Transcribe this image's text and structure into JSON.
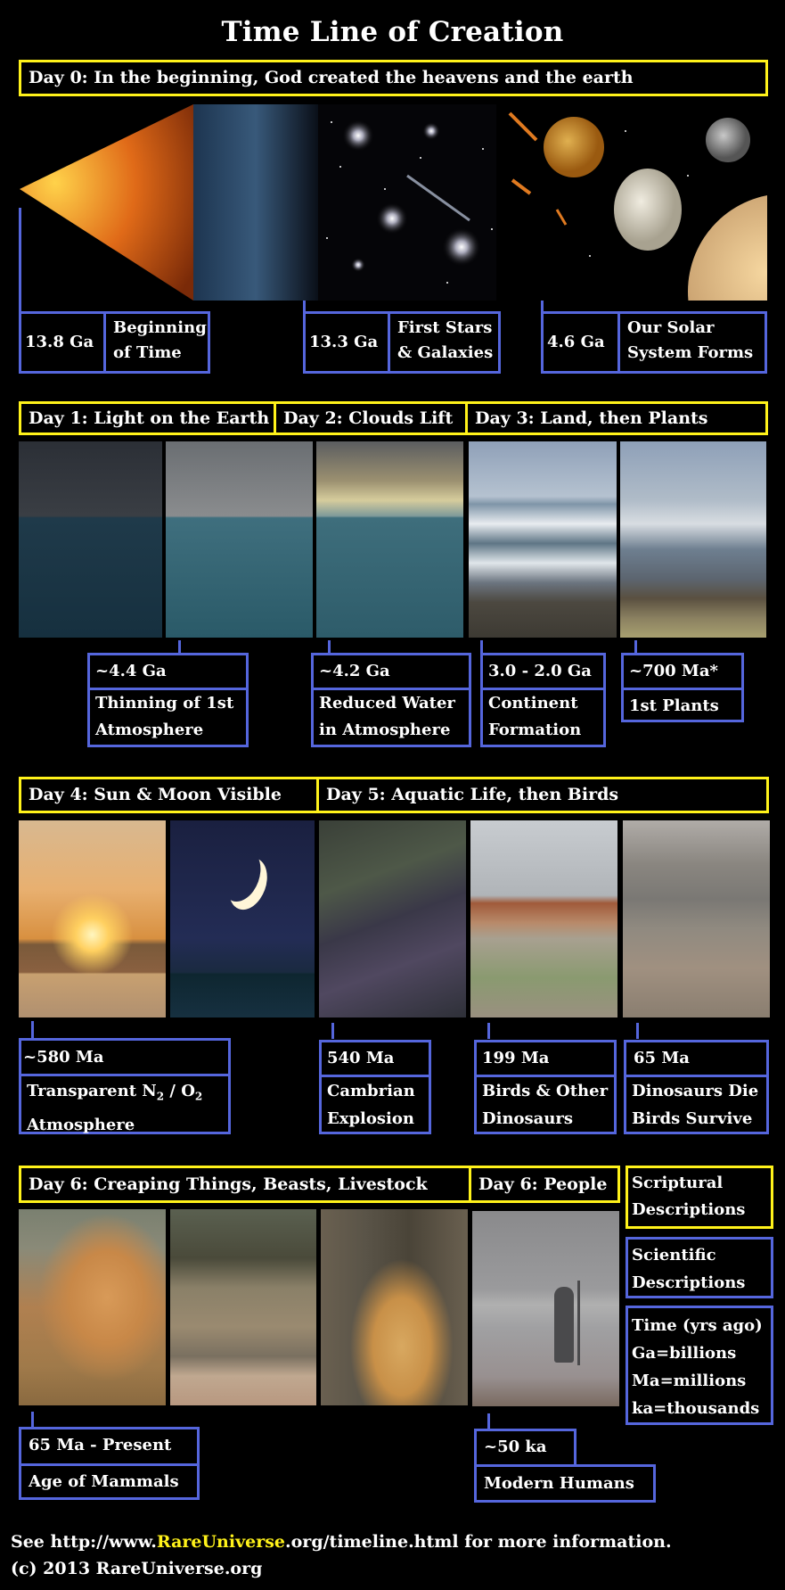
{
  "title": "Time Line of Creation",
  "colors": {
    "scriptural_border": "#fff21a",
    "scientific_border": "#5566dd",
    "background": "#000000"
  },
  "day0": {
    "header": "Day 0: In the beginning, God created the heavens and the earth",
    "image": "cosmic-history-panorama",
    "events": [
      {
        "time": "13.8 Ga",
        "description": [
          "Beginning",
          "of Time"
        ]
      },
      {
        "time": "13.3 Ga",
        "description": [
          "First Stars",
          "& Galaxies"
        ]
      },
      {
        "time": "4.6 Ga",
        "description": [
          "Our Solar",
          "System Forms"
        ]
      }
    ]
  },
  "row1": {
    "headers": [
      "Day 1: Light on the Earth",
      "Day 2: Clouds Lift",
      "Day 3: Land, then Plants"
    ],
    "photos": [
      "dark-stormy-ocean",
      "overcast-ocean",
      "clouds-breaking-ocean",
      "waves-and-shore",
      "shore-with-plants"
    ],
    "events": [
      {
        "time": "~4.4 Ga",
        "description": [
          "Thinning of 1st",
          "Atmosphere"
        ]
      },
      {
        "time": "~4.2 Ga",
        "description": [
          "Reduced Water",
          "in Atmosphere"
        ]
      },
      {
        "time": "3.0 - 2.0 Ga",
        "description": [
          "Continent",
          "Formation"
        ]
      },
      {
        "time": "~700 Ma*",
        "description": [
          "1st Plants"
        ]
      }
    ]
  },
  "row2": {
    "headers": [
      "Day 4: Sun & Moon Visible",
      "Day 5: Aquatic Life, then Birds"
    ],
    "photos": [
      "sunset-over-water",
      "crescent-moon-night-sea",
      "fish-underwater",
      "dinosaurs-and-birds",
      "birds-over-beach"
    ],
    "events": [
      {
        "time": "~580 Ma",
        "description_parts": {
          "pre": "Transparent N",
          "sub1": "2",
          "mid": " / O",
          "sub2": "2"
        },
        "description": [
          "Atmosphere"
        ]
      },
      {
        "time": "540 Ma",
        "description": [
          "Cambrian",
          "Explosion"
        ]
      },
      {
        "time": "199 Ma",
        "description": [
          "Birds & Other",
          "Dinosaurs"
        ]
      },
      {
        "time": "65 Ma",
        "description": [
          "Dinosaurs Die",
          "Birds Survive"
        ]
      }
    ]
  },
  "row3": {
    "headers": [
      "Day 6: Creaping Things, Beasts, Livestock",
      "Day 6: People"
    ],
    "photos": [
      "spiny-mice",
      "grazing-deer",
      "lion-rolling",
      "person-on-beach"
    ],
    "events": [
      {
        "time": "65 Ma - Present",
        "description": [
          "Age of Mammals"
        ]
      },
      {
        "time": "~50 ka",
        "description": [
          "Modern Humans"
        ]
      }
    ]
  },
  "legend": {
    "scriptural": [
      "Scriptural",
      "Descriptions"
    ],
    "scientific": [
      "Scientific",
      "Descriptions"
    ],
    "time": [
      "Time (yrs ago)",
      "Ga=billions",
      "Ma=millions",
      "ka=thousands"
    ]
  },
  "footer": {
    "line1_pre": "See http://www.",
    "line1_highlight": "RareUniverse",
    "line1_post": ".org/timeline.html for more information.",
    "line2": "(c) 2013 RareUniverse.org"
  }
}
